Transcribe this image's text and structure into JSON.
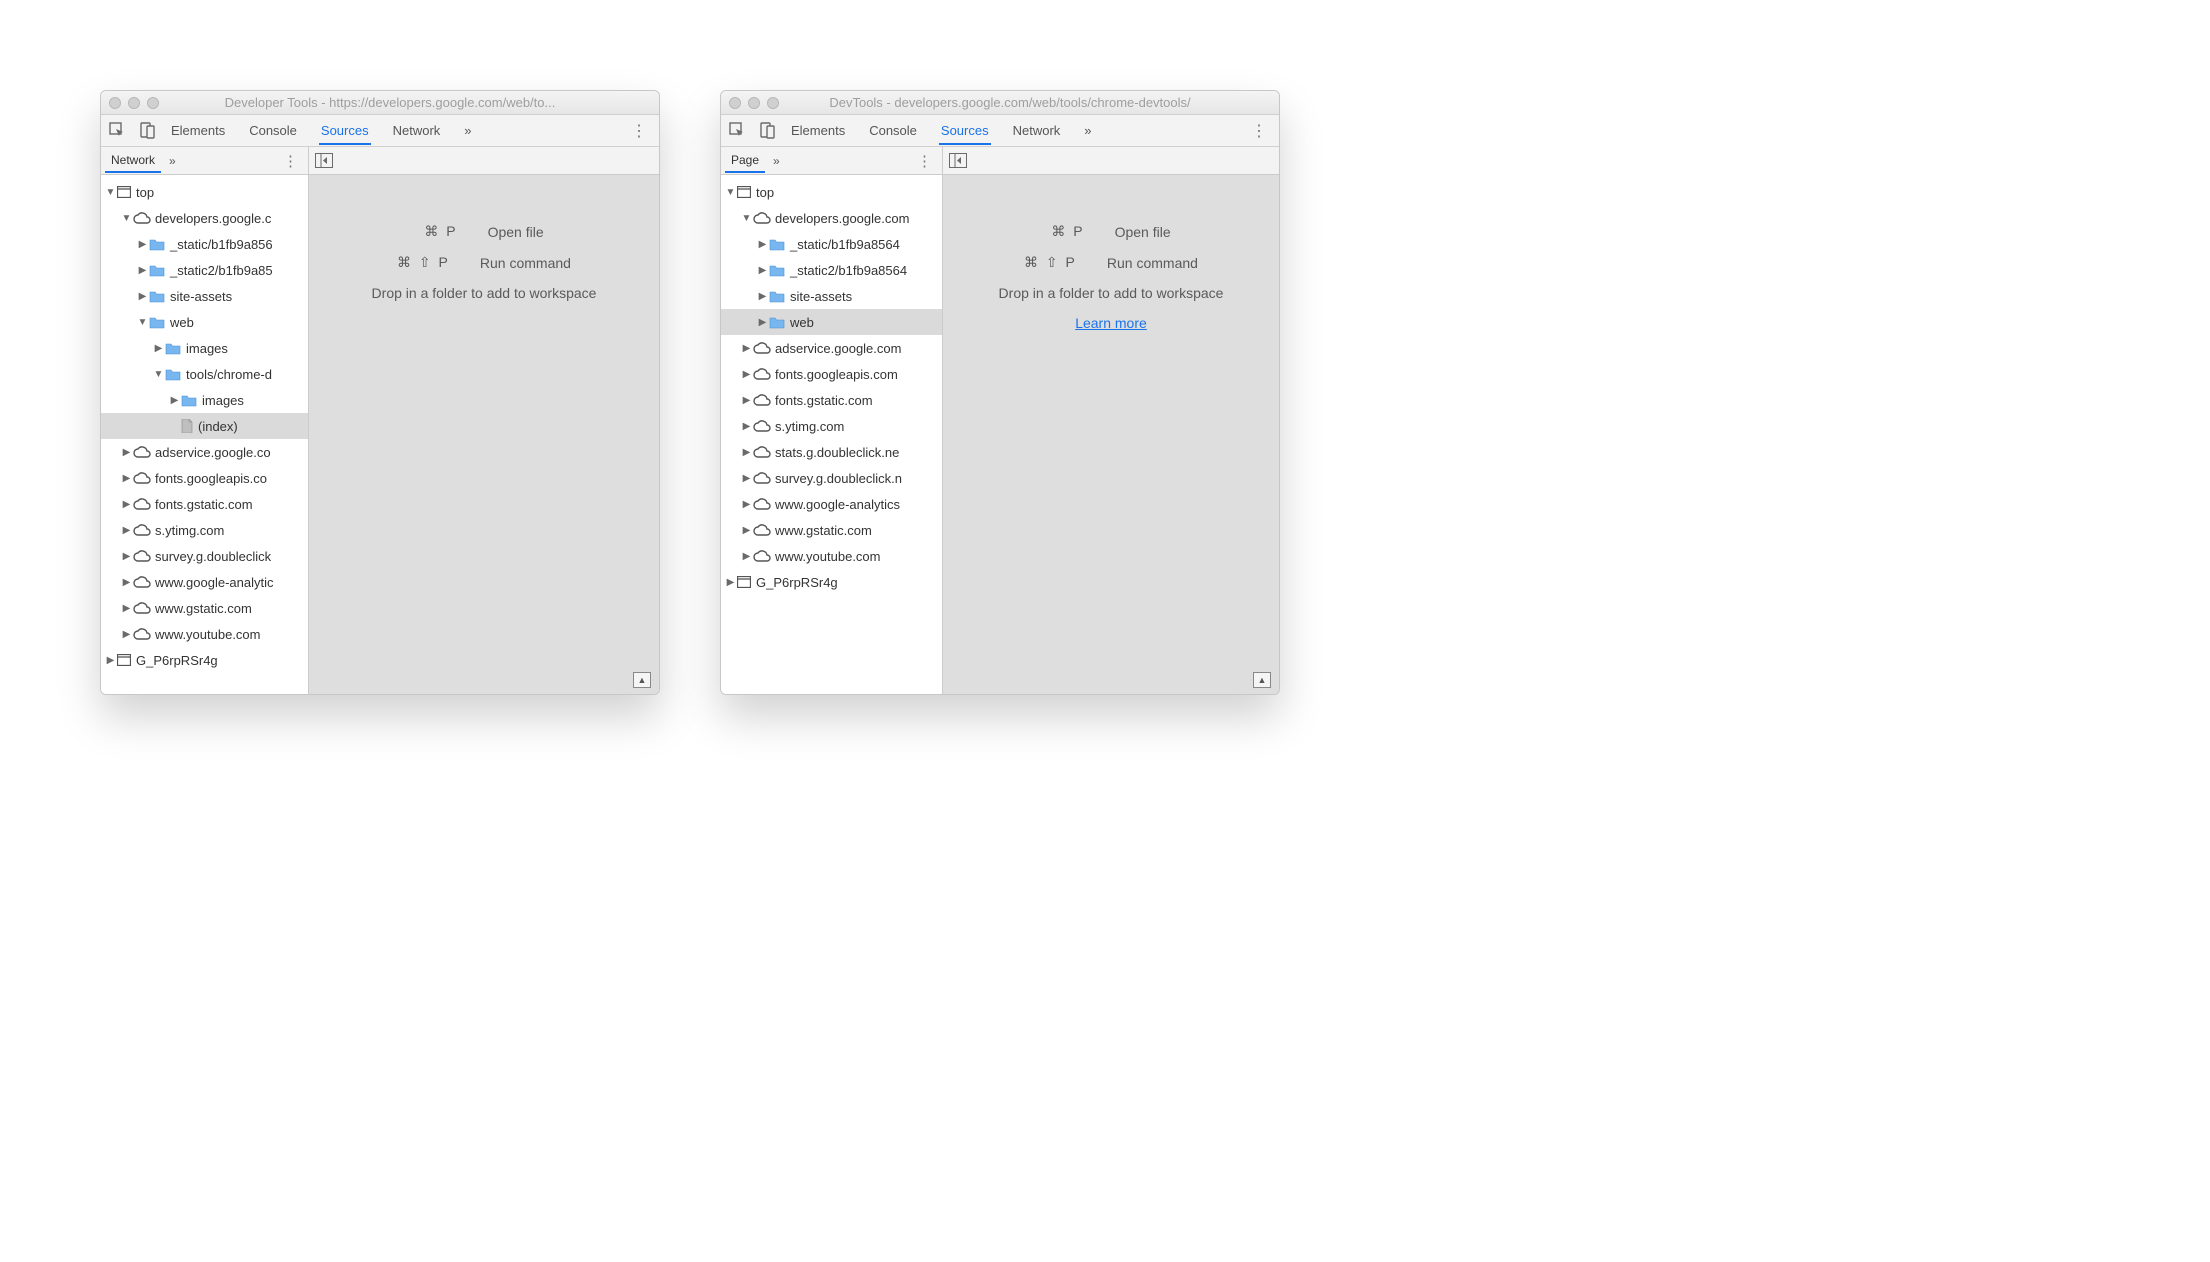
{
  "left": {
    "title": "Developer Tools - https://developers.google.com/web/to...",
    "tabs": {
      "elements": "Elements",
      "console": "Console",
      "sources": "Sources",
      "network": "Network",
      "more": "»"
    },
    "sidebar_tab": "Network",
    "tree": [
      {
        "d": 0,
        "a": "down",
        "i": "frame",
        "t": "top"
      },
      {
        "d": 1,
        "a": "down",
        "i": "cloud",
        "t": "developers.google.c"
      },
      {
        "d": 2,
        "a": "right",
        "i": "folder",
        "t": "_static/b1fb9a856"
      },
      {
        "d": 2,
        "a": "right",
        "i": "folder",
        "t": "_static2/b1fb9a85"
      },
      {
        "d": 2,
        "a": "right",
        "i": "folder",
        "t": "site-assets"
      },
      {
        "d": 2,
        "a": "down",
        "i": "folder",
        "t": "web"
      },
      {
        "d": 3,
        "a": "right",
        "i": "folder",
        "t": "images"
      },
      {
        "d": 3,
        "a": "down",
        "i": "folder",
        "t": "tools/chrome-d"
      },
      {
        "d": 4,
        "a": "right",
        "i": "folder",
        "t": "images"
      },
      {
        "d": 4,
        "a": "none",
        "i": "file",
        "t": "(index)",
        "sel": true
      },
      {
        "d": 1,
        "a": "right",
        "i": "cloud",
        "t": "adservice.google.co"
      },
      {
        "d": 1,
        "a": "right",
        "i": "cloud",
        "t": "fonts.googleapis.co"
      },
      {
        "d": 1,
        "a": "right",
        "i": "cloud",
        "t": "fonts.gstatic.com"
      },
      {
        "d": 1,
        "a": "right",
        "i": "cloud",
        "t": "s.ytimg.com"
      },
      {
        "d": 1,
        "a": "right",
        "i": "cloud",
        "t": "survey.g.doubleclick"
      },
      {
        "d": 1,
        "a": "right",
        "i": "cloud",
        "t": "www.google-analytic"
      },
      {
        "d": 1,
        "a": "right",
        "i": "cloud",
        "t": "www.gstatic.com"
      },
      {
        "d": 1,
        "a": "right",
        "i": "cloud",
        "t": "www.youtube.com"
      },
      {
        "d": 0,
        "a": "right",
        "i": "frame",
        "t": "G_P6rpRSr4g"
      }
    ],
    "hints": {
      "openfile_keys": "⌘ P",
      "openfile_label": "Open file",
      "runcmd_keys": "⌘ ⇧ P",
      "runcmd_label": "Run command",
      "drop": "Drop in a folder to add to workspace"
    }
  },
  "right": {
    "title": "DevTools - developers.google.com/web/tools/chrome-devtools/",
    "tabs": {
      "elements": "Elements",
      "console": "Console",
      "sources": "Sources",
      "network": "Network",
      "more": "»"
    },
    "sidebar_tab": "Page",
    "tree": [
      {
        "d": 0,
        "a": "down",
        "i": "frame",
        "t": "top"
      },
      {
        "d": 1,
        "a": "down",
        "i": "cloud",
        "t": "developers.google.com"
      },
      {
        "d": 2,
        "a": "right",
        "i": "folder",
        "t": "_static/b1fb9a8564"
      },
      {
        "d": 2,
        "a": "right",
        "i": "folder",
        "t": "_static2/b1fb9a8564"
      },
      {
        "d": 2,
        "a": "right",
        "i": "folder",
        "t": "site-assets"
      },
      {
        "d": 2,
        "a": "right",
        "i": "folder",
        "t": "web",
        "sel": true
      },
      {
        "d": 1,
        "a": "right",
        "i": "cloud",
        "t": "adservice.google.com"
      },
      {
        "d": 1,
        "a": "right",
        "i": "cloud",
        "t": "fonts.googleapis.com"
      },
      {
        "d": 1,
        "a": "right",
        "i": "cloud",
        "t": "fonts.gstatic.com"
      },
      {
        "d": 1,
        "a": "right",
        "i": "cloud",
        "t": "s.ytimg.com"
      },
      {
        "d": 1,
        "a": "right",
        "i": "cloud",
        "t": "stats.g.doubleclick.ne"
      },
      {
        "d": 1,
        "a": "right",
        "i": "cloud",
        "t": "survey.g.doubleclick.n"
      },
      {
        "d": 1,
        "a": "right",
        "i": "cloud",
        "t": "www.google-analytics"
      },
      {
        "d": 1,
        "a": "right",
        "i": "cloud",
        "t": "www.gstatic.com"
      },
      {
        "d": 1,
        "a": "right",
        "i": "cloud",
        "t": "www.youtube.com"
      },
      {
        "d": 0,
        "a": "right",
        "i": "frame",
        "t": "G_P6rpRSr4g"
      }
    ],
    "hints": {
      "openfile_keys": "⌘ P",
      "openfile_label": "Open file",
      "runcmd_keys": "⌘ ⇧ P",
      "runcmd_label": "Run command",
      "drop": "Drop in a folder to add to workspace",
      "learn": "Learn more"
    }
  }
}
